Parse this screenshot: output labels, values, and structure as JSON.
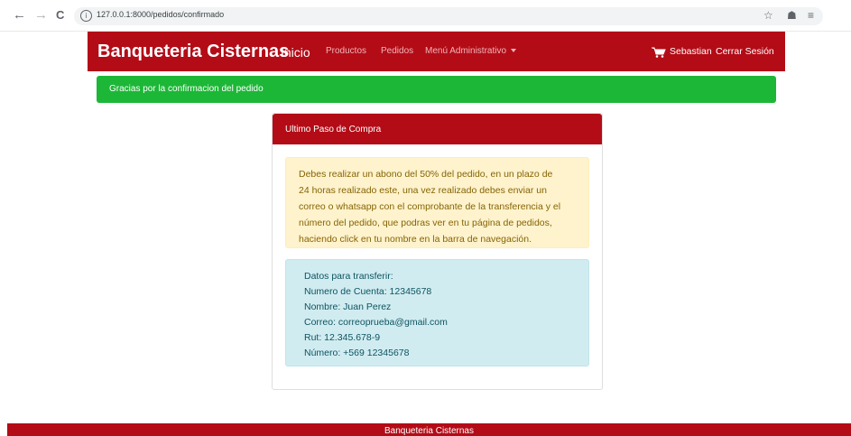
{
  "browser": {
    "url": "127.0.0.1:8000/pedidos/confirmado",
    "back_icon": "←",
    "forward_icon": "→",
    "reload_icon": "C",
    "info_icon": "i",
    "star_icon": "☆",
    "extensions_icon": "☗",
    "menu_icon": "≡"
  },
  "navbar": {
    "brand": "Banqueteria Cisternas",
    "inicio": "Inicio",
    "productos": "Productos",
    "pedidos": "Pedidos",
    "admin_menu": "Menú Administrativo",
    "user": "Sebastian",
    "logout": "Cerrar Sesión",
    "color": "#b30c17"
  },
  "success_alert": {
    "text": "Gracias por la confirmacion del pedido",
    "color": "#1cb736"
  },
  "card": {
    "title": "Ultimo Paso de Compra",
    "warning_lines": [
      "Debes realizar un abono del 50% del pedido, en un plazo de",
      "24 horas realizado este, una vez realizado debes enviar un",
      "correo o whatsapp con el comprobante de la transferencia y el",
      "número del pedido, que podras ver en tu página de pedidos,",
      "haciendo click en tu nombre en la barra de navegación."
    ],
    "transfer_lines": [
      "Datos para transferir:",
      "Numero de Cuenta: 12345678",
      "Nombre: Juan Perez",
      "Correo: correoprueba@gmail.com",
      "Rut: 12.345.678-9",
      "Número: +569 12345678"
    ]
  },
  "footer": {
    "text": "Banqueteria Cisternas"
  }
}
